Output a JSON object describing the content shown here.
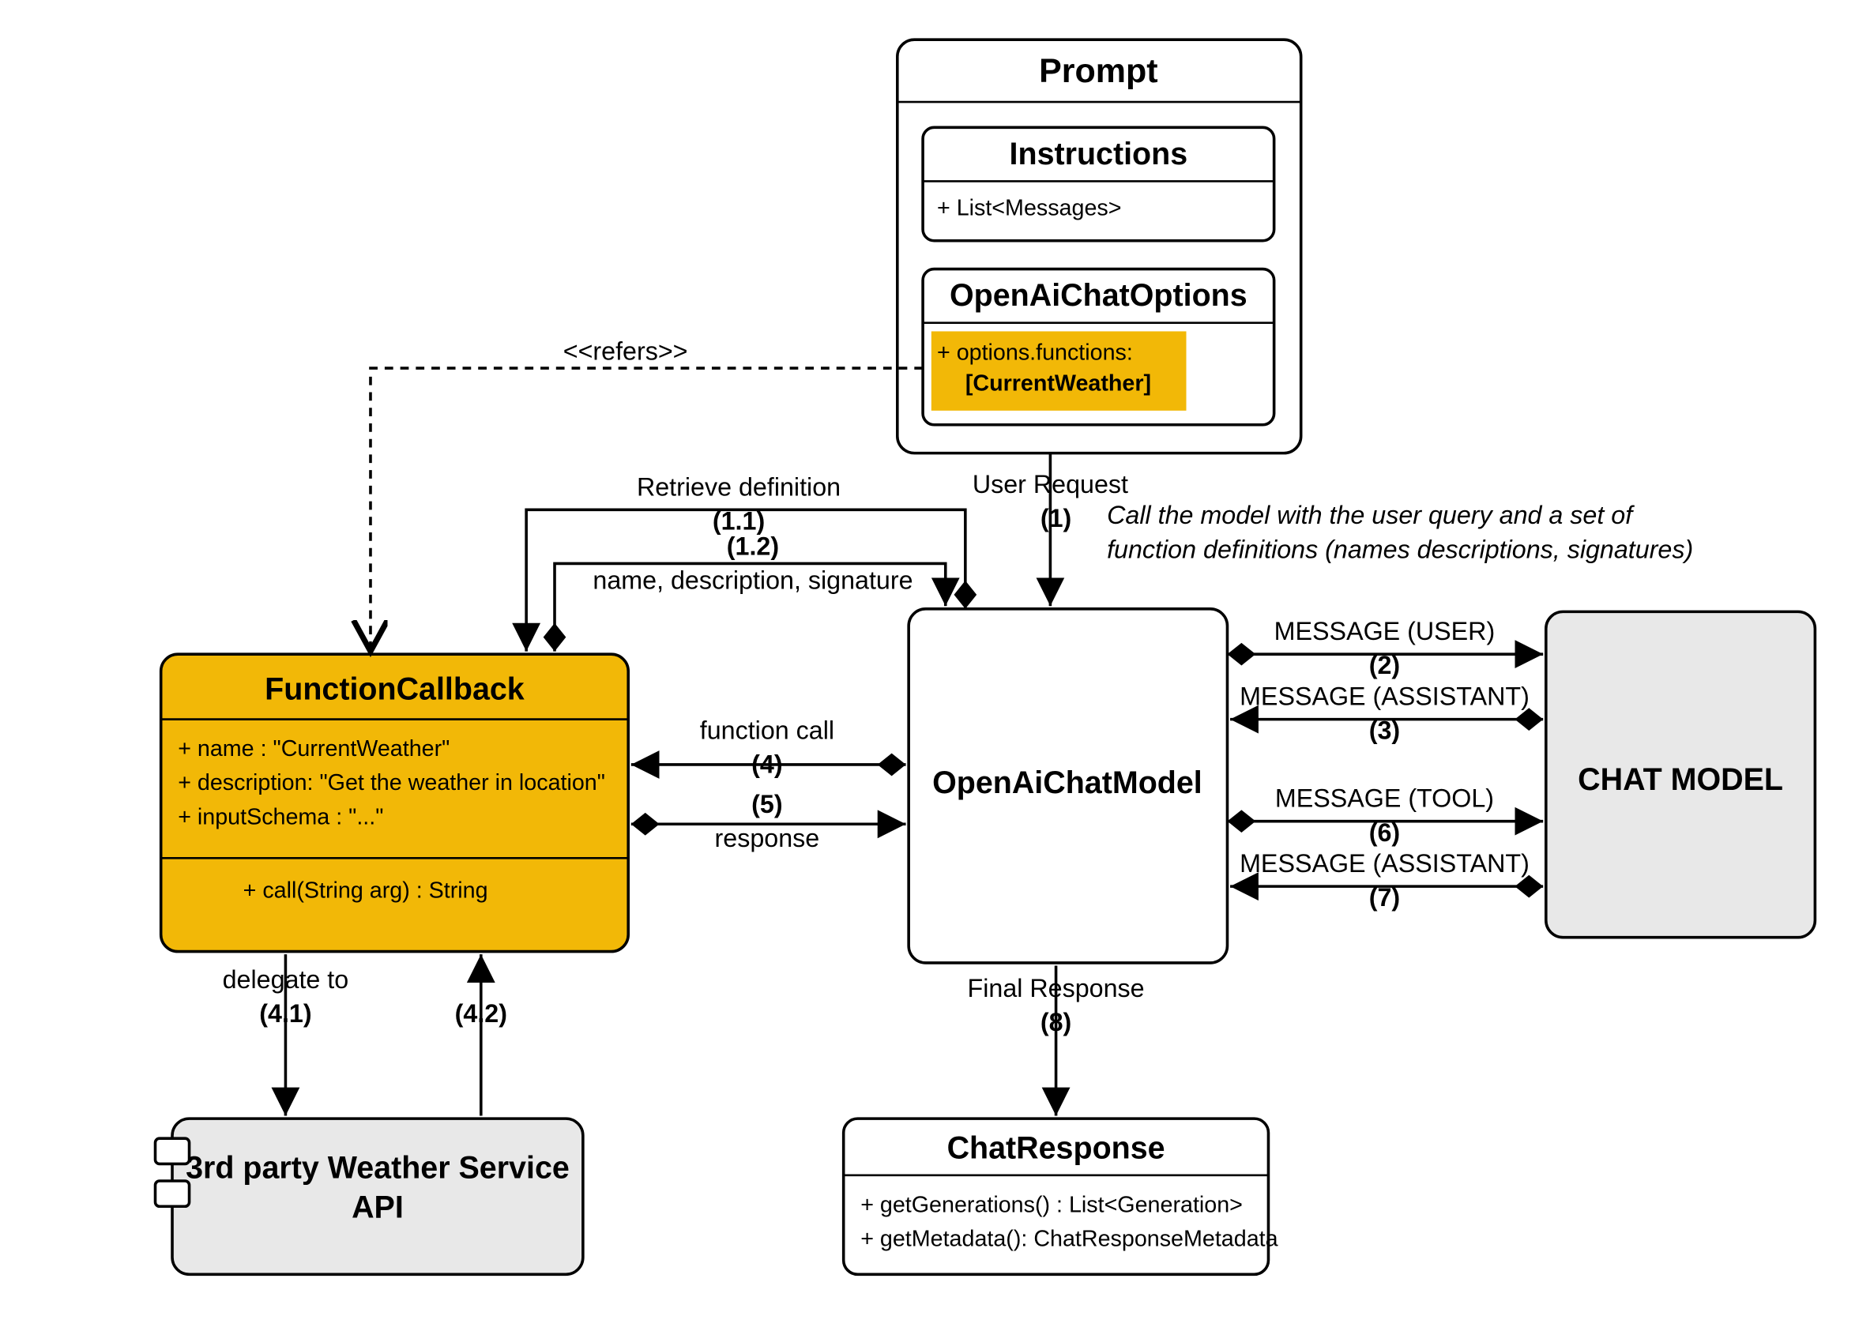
{
  "prompt": {
    "title": "Prompt",
    "instructions": {
      "title": "Instructions",
      "attr": "+ List<Messages>"
    },
    "options": {
      "title": "OpenAiChatOptions",
      "attr1": "+ options.functions:",
      "attr2": "[CurrentWeather]"
    }
  },
  "functionCallback": {
    "title": "FunctionCallback",
    "attrs": {
      "name": "+ name : \"CurrentWeather\"",
      "description": "+ description: \"Get the weather in location\"",
      "inputSchema": "+ inputSchema : \"...\""
    },
    "method": "+ call(String arg) : String"
  },
  "openAiChatModel": {
    "title": "OpenAiChatModel"
  },
  "chatModel": {
    "title": "CHAT MODEL"
  },
  "weatherService": {
    "line1": "3rd party Weather Service",
    "line2": "API"
  },
  "chatResponse": {
    "title": "ChatResponse",
    "attr1": "+ getGenerations() : List<Generation>",
    "attr2": "+ getMetadata(): ChatResponseMetadata"
  },
  "labels": {
    "refers": "<<refers>>",
    "retrieveDef": "Retrieve definition",
    "step1_1": "(1.1)",
    "step1_2": "(1.2)",
    "nameDesc": "name, description, signature",
    "userRequest": "User Request",
    "step1": "(1)",
    "callModel1": "Call the model with the user query and a set of",
    "callModel2": "function definitions (names descriptions, signatures)",
    "msgUser": "MESSAGE (USER)",
    "step2": "(2)",
    "msgAssistant3": "MESSAGE (ASSISTANT)",
    "step3": "(3)",
    "functionCall": "function call",
    "step4": "(4)",
    "response": "response",
    "step5": "(5)",
    "msgTool": "MESSAGE (TOOL)",
    "step6": "(6)",
    "msgAssistant7": "MESSAGE (ASSISTANT)",
    "step7": "(7)",
    "delegateTo": "delegate to",
    "step4_1": "(4.1)",
    "step4_2": "(4.2)",
    "finalResponse": "Final Response",
    "step8": "(8)"
  }
}
